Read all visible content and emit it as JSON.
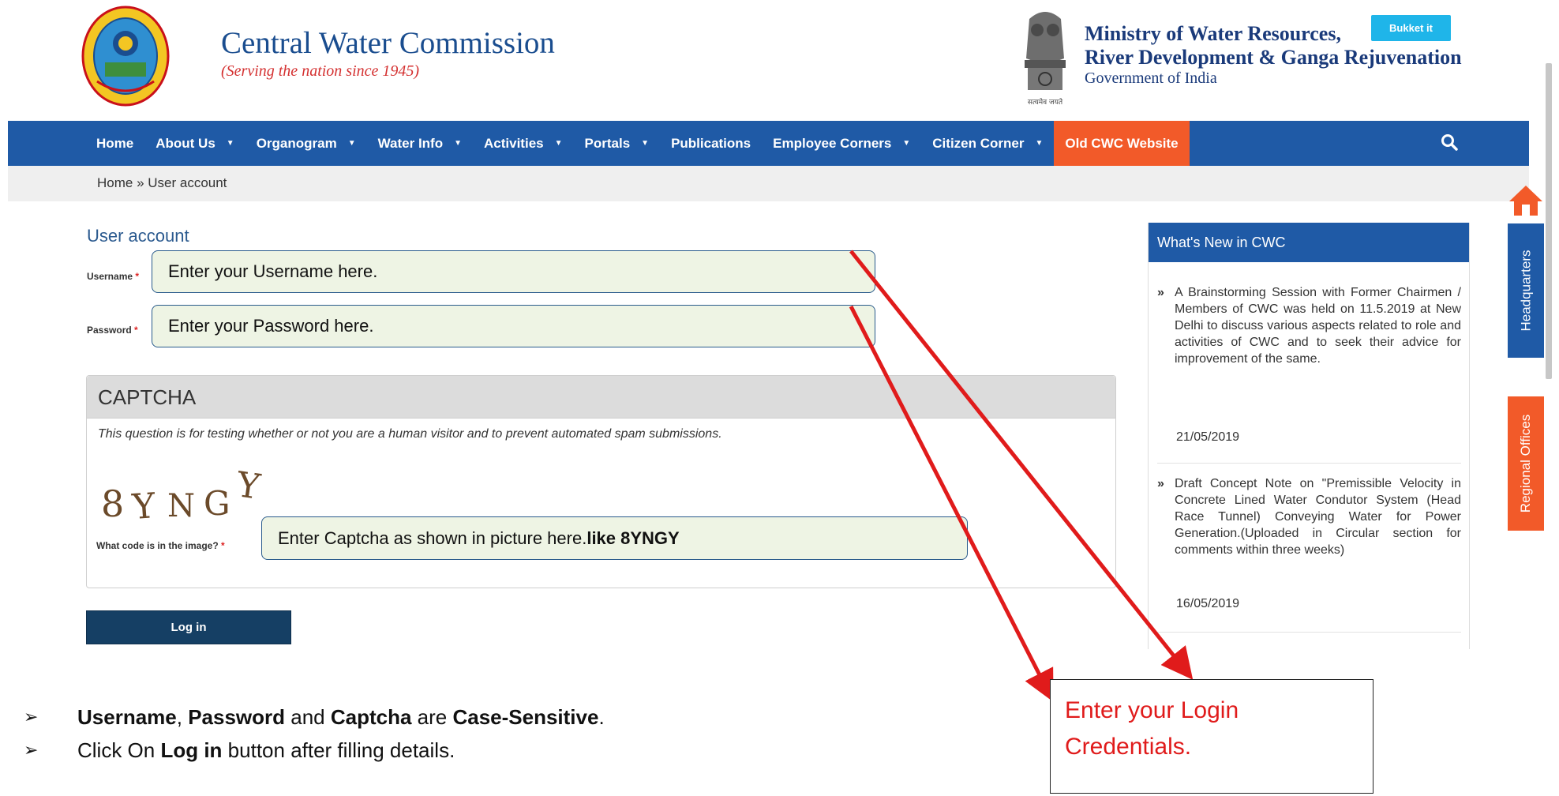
{
  "header": {
    "site_title": "Central Water Commission",
    "tagline": "(Serving the nation since 1945)",
    "ministry_line1": "Ministry of Water Resources,",
    "ministry_line2": "River Development & Ganga Rejuvenation",
    "ministry_line3": "Government of India",
    "bukket_label": "Bukket it",
    "emblem_caption": "सत्यमेव जयते"
  },
  "nav": {
    "items": [
      {
        "label": "Home",
        "dropdown": false
      },
      {
        "label": "About Us",
        "dropdown": true
      },
      {
        "label": "Organogram",
        "dropdown": true
      },
      {
        "label": "Water Info",
        "dropdown": true
      },
      {
        "label": "Activities",
        "dropdown": true
      },
      {
        "label": "Portals",
        "dropdown": true
      },
      {
        "label": "Publications",
        "dropdown": false
      },
      {
        "label": "Employee Corners",
        "dropdown": true
      },
      {
        "label": "Citizen Corner",
        "dropdown": true
      },
      {
        "label": "Old CWC Website",
        "dropdown": false
      }
    ],
    "search_icon": "search-icon"
  },
  "breadcrumb": "Home » User account",
  "form": {
    "title": "User account",
    "username_label": "Username",
    "password_label": "Password",
    "required_mark": "*",
    "username_callout": "Enter your Username here.",
    "password_callout": "Enter your Password here.",
    "captcha_title": "CAPTCHA",
    "captcha_description": "This question is for testing whether or not you are a human visitor and to prevent automated spam submissions.",
    "captcha_image_text": "8YNGY",
    "captcha_label": "What code is in the image?",
    "captcha_callout_prefix": "Enter  Captcha as shown in picture here.",
    "captcha_callout_bold": "like 8YNGY",
    "login_label": "Log in"
  },
  "sidebar": {
    "title": "What's New in CWC",
    "news": [
      {
        "text": "A Brainstorming Session with Former Chairmen / Members of CWC was held on 11.5.2019 at New Delhi to discuss various aspects related to role and activities of CWC and to seek their advice for improvement of the same.",
        "date": "21/05/2019"
      },
      {
        "text": "Draft Concept Note on \"Premissible Velocity in Concrete Lined Water Condutor System (Head Race Tunnel) Conveying Water for Power Generation.(Uploaded in Circular section for comments within three weeks)",
        "date": "16/05/2019"
      }
    ],
    "bullet": "»"
  },
  "side_tabs": {
    "headquarters": "Headquarters",
    "regional_offices": "Regional Offices"
  },
  "annotation": {
    "line1": "Enter your Login",
    "line2": "Credentials."
  },
  "notes": {
    "bullet": "➢",
    "note1": {
      "w1": "Username",
      "sep1": ", ",
      "w2": "Password",
      "sep2": " and ",
      "w3": "Captcha",
      "sep3": " are ",
      "w4": "Case-Sensitive",
      "end": "."
    },
    "note2": {
      "pre": "Click On ",
      "bold": "Log in",
      "post": " button after filling details."
    }
  },
  "colors": {
    "nav_blue": "#1f5aa6",
    "accent_orange": "#f25a29",
    "callout_fill": "#eef4e4",
    "arrow_red": "#e01b1b"
  }
}
